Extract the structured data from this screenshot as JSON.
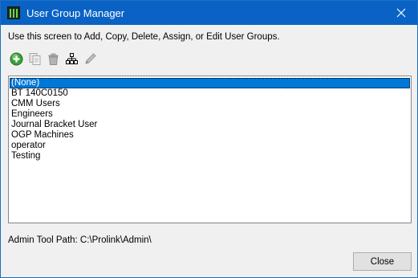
{
  "window": {
    "title": "User Group Manager",
    "titlebar_color": "#0a63c4"
  },
  "instructions": "Use this screen to Add, Copy, Delete, Assign, or Edit User Groups.",
  "toolbar": {
    "buttons": [
      {
        "icon": "add-icon",
        "enabled": true
      },
      {
        "icon": "copy-icon",
        "enabled": false
      },
      {
        "icon": "delete-icon",
        "enabled": false
      },
      {
        "icon": "assign-icon",
        "enabled": true
      },
      {
        "icon": "edit-icon",
        "enabled": false
      }
    ]
  },
  "groups": {
    "items": [
      "(None)",
      "BT 140C0150",
      "CMM Users",
      "Engineers",
      "Journal Bracket User",
      "OGP Machines",
      "operator",
      "Testing"
    ],
    "selected_index": 0,
    "selection_color": "#0078d7"
  },
  "footer": {
    "path_text": "Admin Tool Path: C:\\Prolink\\Admin\\",
    "close_label": "Close"
  }
}
